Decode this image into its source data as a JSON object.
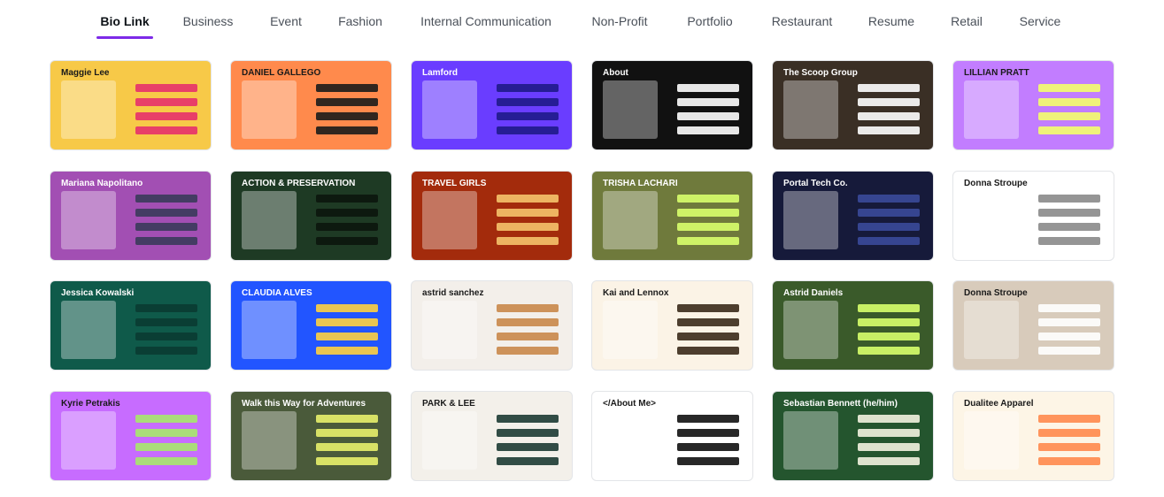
{
  "tabs": [
    {
      "label": "Bio Link",
      "active": true
    },
    {
      "label": "Business",
      "active": false
    },
    {
      "label": "Event",
      "active": false
    },
    {
      "label": "Fashion",
      "active": false
    },
    {
      "label": "Internal Communication",
      "active": false
    },
    {
      "label": "Non-Profit",
      "active": false
    },
    {
      "label": "Portfolio",
      "active": false
    },
    {
      "label": "Restaurant",
      "active": false
    },
    {
      "label": "Resume",
      "active": false
    },
    {
      "label": "Retail",
      "active": false
    },
    {
      "label": "Service",
      "active": false
    }
  ],
  "accent": "#7d2ae8",
  "cards": [
    {
      "title": "Maggie Lee",
      "bg": "#f7c948",
      "accent": "#e6306c"
    },
    {
      "title": "DANIEL GALLEGO",
      "bg": "#ff8a4c",
      "accent": "#1b1b1b"
    },
    {
      "title": "Lamford",
      "bg": "#6a3dff",
      "accent": "#1f1a8a"
    },
    {
      "title": "About",
      "bg": "#111111",
      "accent": "#ffffff"
    },
    {
      "title": "The Scoop Group",
      "bg": "#3a2f25",
      "accent": "#ffffff"
    },
    {
      "title": "LILLIAN PRATT",
      "bg": "#c27dff",
      "accent": "#f4ff6b"
    },
    {
      "title": "Mariana Napolitano",
      "bg": "#a24fb3",
      "accent": "#3a3a5a"
    },
    {
      "title": "ACTION & PRESERVATION",
      "bg": "#1e3a24",
      "accent": "#0b160d"
    },
    {
      "title": "TRAVEL GIRLS",
      "bg": "#a32b0c",
      "accent": "#f5c36b"
    },
    {
      "title": "TRISHA LACHARI",
      "bg": "#6f7a3c",
      "accent": "#d8ff6b"
    },
    {
      "title": "Portal Tech Co.",
      "bg": "#161a3a",
      "accent": "#3a4a9a"
    },
    {
      "title": "Donna Stroupe",
      "bg": "#ffffff",
      "accent": "#8a8a8a"
    },
    {
      "title": "Jessica Kowalski",
      "bg": "#0f5a4a",
      "accent": "#0a3b32"
    },
    {
      "title": "CLAUDIA ALVES",
      "bg": "#2255ff",
      "accent": "#ffd23f"
    },
    {
      "title": "astrid sanchez",
      "bg": "#f3efea",
      "accent": "#c9874a"
    },
    {
      "title": "Kai and Lennox",
      "bg": "#fbf3e6",
      "accent": "#3a2a1a"
    },
    {
      "title": "Astrid Daniels",
      "bg": "#3a5a2a",
      "accent": "#d8ff6b"
    },
    {
      "title": "Donna Stroupe",
      "bg": "#d8cbbb",
      "accent": "#ffffff"
    },
    {
      "title": "Kyrie Petrakis",
      "bg": "#c76cff",
      "accent": "#a6e96b"
    },
    {
      "title": "Walk this Way for Adventures",
      "bg": "#4a5a3a",
      "accent": "#e8f06b"
    },
    {
      "title": "PARK & LEE",
      "bg": "#f3f0ea",
      "accent": "#1c3a33"
    },
    {
      "title": "</About Me>",
      "bg": "#ffffff",
      "accent": "#111111"
    },
    {
      "title": "Sebastian Bennett (he/him)",
      "bg": "#24552e",
      "accent": "#f3f3e0"
    },
    {
      "title": "Dualitee Apparel",
      "bg": "#fdf5e6",
      "accent": "#ff8a4c"
    }
  ]
}
